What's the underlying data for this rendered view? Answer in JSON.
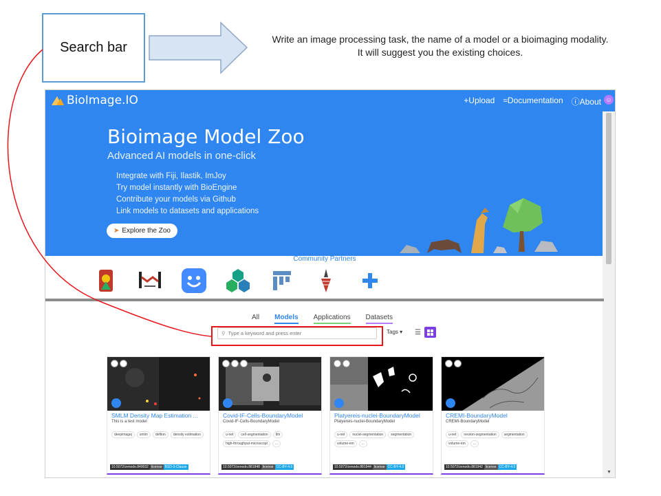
{
  "annotation": {
    "callout_label": "Search bar",
    "instructions": "Write an image processing task, the name of a model or a bioimaging modality. It will suggest you the existing choices.",
    "highlight_color": "#e8161b",
    "callout_border_color": "#5b9bd5"
  },
  "app": {
    "brand": "BioImage.IO",
    "nav": {
      "upload": "+Upload",
      "documentation": "≈Documentation",
      "about": "ⓘAbout"
    },
    "accent_color": "#2f86f0"
  },
  "hero": {
    "title": "Bioimage Model Zoo",
    "subtitle": "Advanced AI models in one-click",
    "features": [
      "Integrate with Fiji, Ilastik, ImJoy",
      "Try model instantly with BioEngine",
      "Contribute your models via Github",
      "Link models to datasets and applications"
    ],
    "explore_button": "Explore the Zoo"
  },
  "partners": {
    "title": "Community Partners",
    "icons": [
      "ilastik-icon",
      "deepimagej-icon",
      "imjoy-icon",
      "zerocostdl4mic-icon",
      "fiji-icon",
      "hpa-icon",
      "add-icon"
    ]
  },
  "tabs": [
    {
      "label": "All"
    },
    {
      "label": "Models"
    },
    {
      "label": "Applications"
    },
    {
      "label": "Datasets"
    }
  ],
  "search": {
    "placeholder": "Type a keyword and press enter",
    "tags_label": "Tags ▾"
  },
  "cards": [
    {
      "title": "SMLM Density Map Estimation ...",
      "description": "This is a test model",
      "tags": [
        "deepimagej",
        "smlm",
        "deftion",
        "density estimation"
      ],
      "doi": "10.5072/zenodo.849032",
      "license_label": "license",
      "license": "BSD-3-Clause"
    },
    {
      "title": "Covid-IF-Cells-BoundaryModel",
      "description": "Covid-IF-Cells-BoundaryModel",
      "tags": [
        "u-net",
        "cell-segmentation",
        "Ilm",
        "high-throughput-microscopt",
        "..."
      ],
      "doi": "10.5072/zenodo.881848",
      "license_label": "license",
      "license": "CC-BY-4.0"
    },
    {
      "title": "Platyereis-nuclei-BoundaryModel",
      "description": "Platyereis-nuclei-BoundaryModel",
      "tags": [
        "u-net",
        "nuclei-segmentation",
        "segmentation",
        "volume-em",
        "..."
      ],
      "doi": "10.5072/zenodo.881944",
      "license_label": "license",
      "license": "CC-BY-4.0"
    },
    {
      "title": "CREMI-BoundaryModel",
      "description": "CREMI-BoundaryModel",
      "tags": [
        "u-net",
        "neuron-segmentation",
        "segmentation",
        "volume-em",
        "..."
      ],
      "doi": "10.5072/zenodo.881942",
      "license_label": "license",
      "license": "CC-BY-4.0"
    }
  ]
}
